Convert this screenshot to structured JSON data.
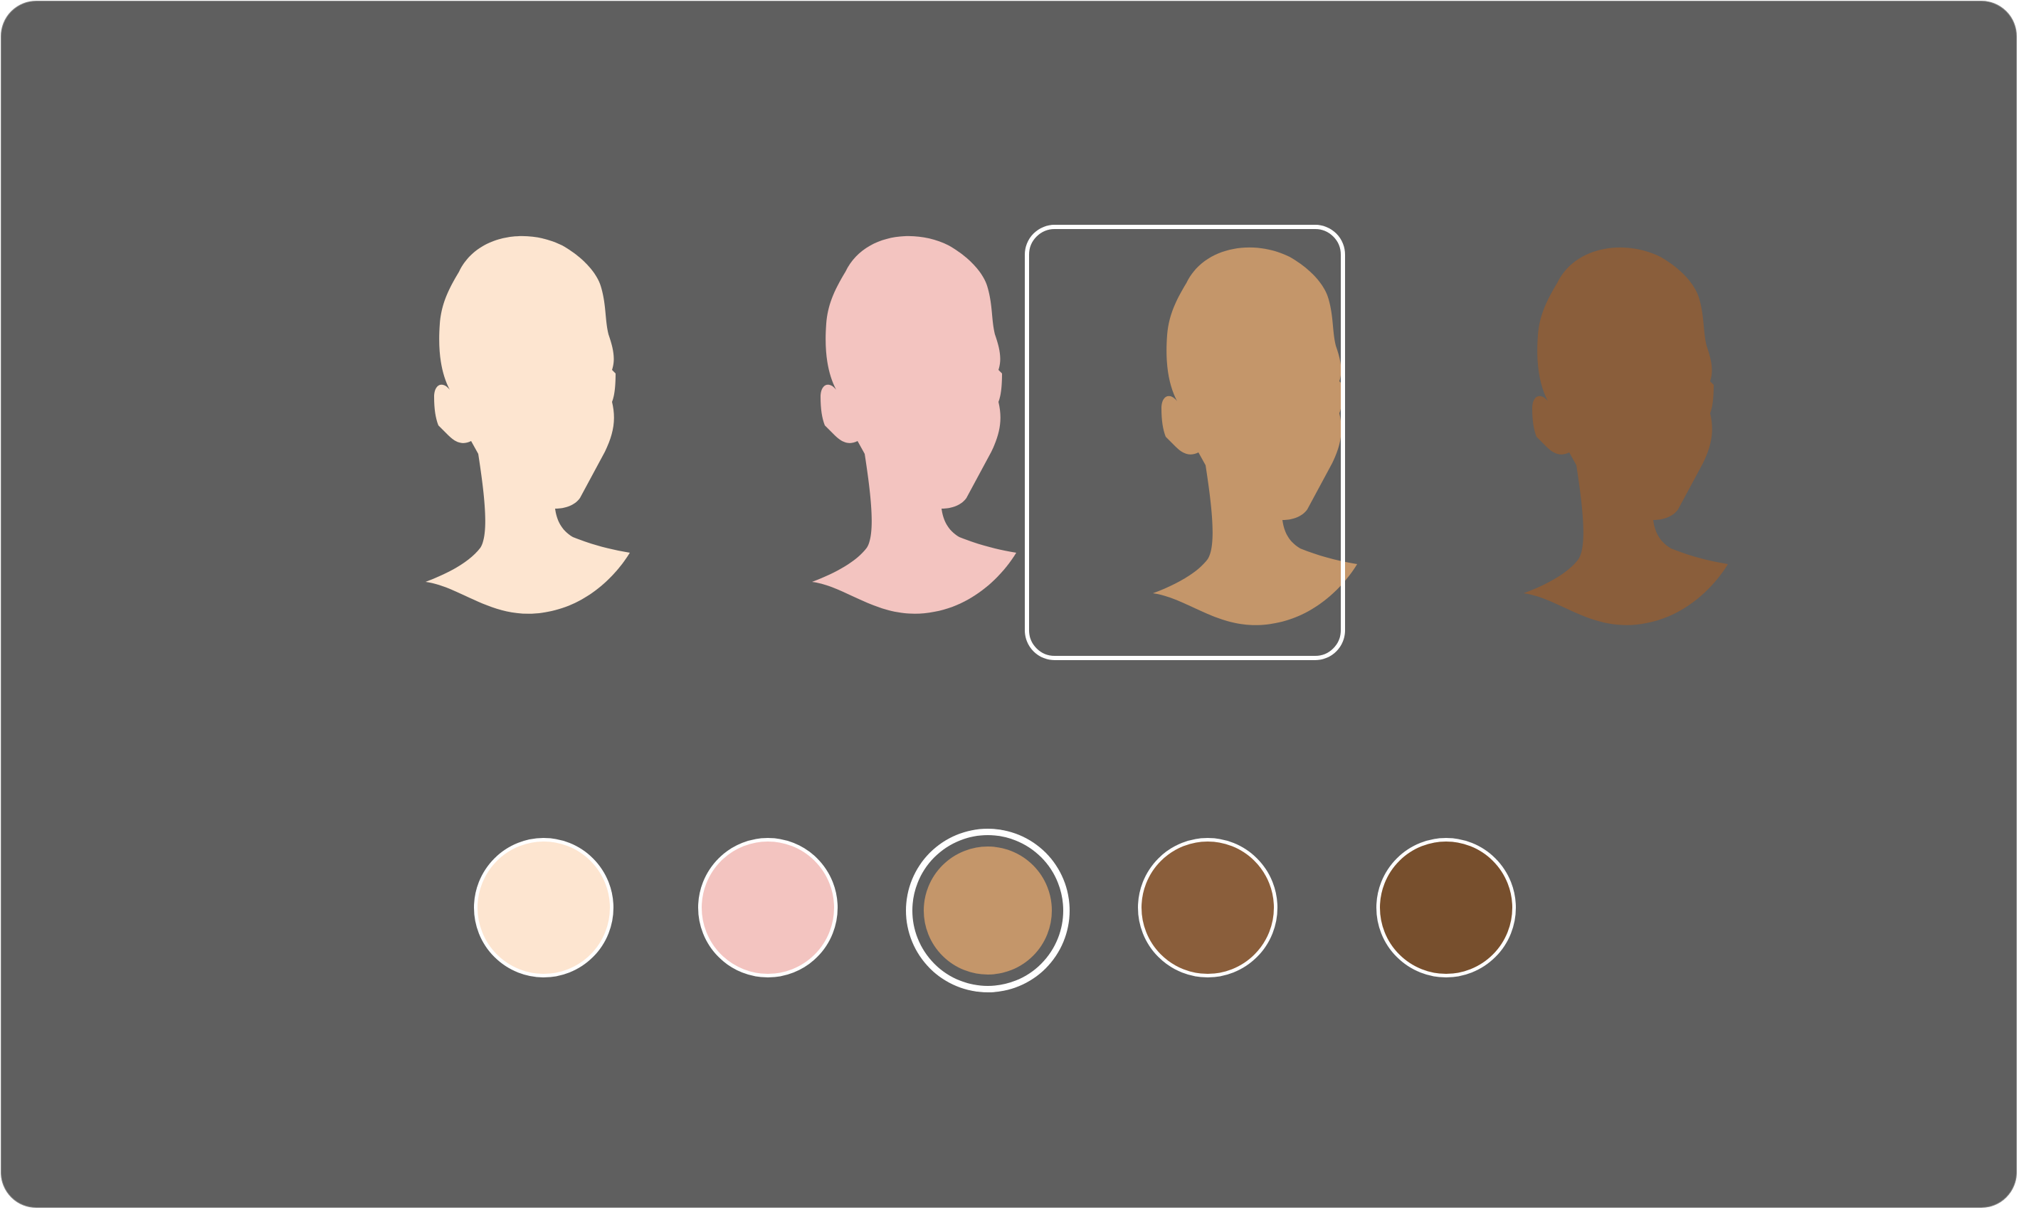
{
  "skin_tones": [
    {
      "name": "light",
      "color": "#fde5d0"
    },
    {
      "name": "pink",
      "color": "#f3c4c0"
    },
    {
      "name": "tan",
      "color": "#c4966a"
    },
    {
      "name": "brown",
      "color": "#8a5e3b"
    },
    {
      "name": "dark-brown",
      "color": "#774f2d"
    }
  ],
  "avatars": [
    {
      "tone": "light",
      "icon": "head-silhouette-icon",
      "selected": false
    },
    {
      "tone": "pink",
      "icon": "head-silhouette-icon",
      "selected": false
    },
    {
      "tone": "tan",
      "icon": "head-silhouette-icon",
      "selected": true
    },
    {
      "tone": "brown",
      "icon": "head-silhouette-icon",
      "selected": false
    }
  ],
  "selected_tone": "tan",
  "colors": {
    "background": "#5f5f5f",
    "selection_outline": "#ffffff"
  }
}
